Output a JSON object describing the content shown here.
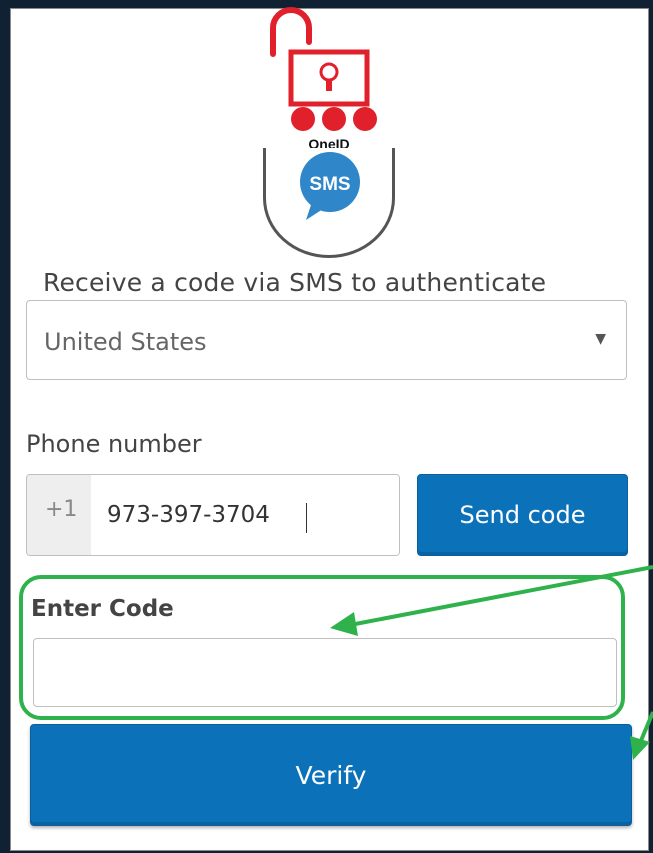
{
  "logo": {
    "brand_text": "OneID",
    "icon": "padlock-cart-icon",
    "color": "#e0202a"
  },
  "sms_badge": {
    "text": "SMS",
    "icon": "sms-bubble-icon",
    "color": "#2f86c8"
  },
  "title": "Receive a code via SMS to authenticate",
  "country_select": {
    "selected": "United States",
    "caret": "▼"
  },
  "phone": {
    "label": "Phone number",
    "prefix": "+1",
    "value": "973-397-3704"
  },
  "send_button": {
    "label": "Send code"
  },
  "code": {
    "label": "Enter Code",
    "value": ""
  },
  "verify_button": {
    "label": "Verify"
  },
  "colors": {
    "accent": "#0b71b9",
    "highlight": "#2fb24c",
    "background": "#0f2132"
  },
  "annotations": {
    "highlight_arrow_color": "#2fb24c"
  }
}
